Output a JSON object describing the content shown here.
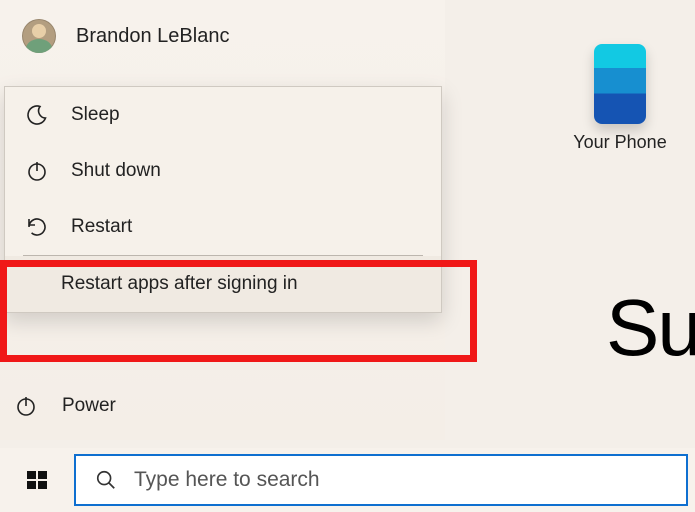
{
  "user": {
    "name": "Brandon LeBlanc"
  },
  "powerMenu": {
    "sleep": "Sleep",
    "shutdown": "Shut down",
    "restart": "Restart",
    "restartApps": "Restart apps after signing in"
  },
  "power": {
    "label": "Power"
  },
  "search": {
    "placeholder": "Type here to search"
  },
  "desktop": {
    "yourPhone": "Your Phone",
    "partialText": "Su"
  }
}
